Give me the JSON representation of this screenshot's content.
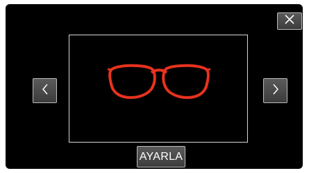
{
  "controls": {
    "close_icon": "close-icon",
    "prev_icon": "chevron-left-icon",
    "next_icon": "chevron-right-icon",
    "set_label": "AYARLA"
  },
  "preview": {
    "item": "red-glasses",
    "item_color": "#e8321e"
  }
}
